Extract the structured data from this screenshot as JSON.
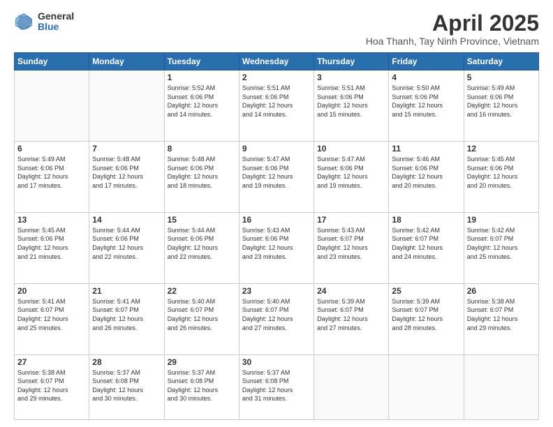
{
  "logo": {
    "general": "General",
    "blue": "Blue"
  },
  "header": {
    "title": "April 2025",
    "subtitle": "Hoa Thanh, Tay Ninh Province, Vietnam"
  },
  "weekdays": [
    "Sunday",
    "Monday",
    "Tuesday",
    "Wednesday",
    "Thursday",
    "Friday",
    "Saturday"
  ],
  "weeks": [
    [
      {
        "day": "",
        "info": ""
      },
      {
        "day": "",
        "info": ""
      },
      {
        "day": "1",
        "info": "Sunrise: 5:52 AM\nSunset: 6:06 PM\nDaylight: 12 hours\nand 14 minutes."
      },
      {
        "day": "2",
        "info": "Sunrise: 5:51 AM\nSunset: 6:06 PM\nDaylight: 12 hours\nand 14 minutes."
      },
      {
        "day": "3",
        "info": "Sunrise: 5:51 AM\nSunset: 6:06 PM\nDaylight: 12 hours\nand 15 minutes."
      },
      {
        "day": "4",
        "info": "Sunrise: 5:50 AM\nSunset: 6:06 PM\nDaylight: 12 hours\nand 15 minutes."
      },
      {
        "day": "5",
        "info": "Sunrise: 5:49 AM\nSunset: 6:06 PM\nDaylight: 12 hours\nand 16 minutes."
      }
    ],
    [
      {
        "day": "6",
        "info": "Sunrise: 5:49 AM\nSunset: 6:06 PM\nDaylight: 12 hours\nand 17 minutes."
      },
      {
        "day": "7",
        "info": "Sunrise: 5:48 AM\nSunset: 6:06 PM\nDaylight: 12 hours\nand 17 minutes."
      },
      {
        "day": "8",
        "info": "Sunrise: 5:48 AM\nSunset: 6:06 PM\nDaylight: 12 hours\nand 18 minutes."
      },
      {
        "day": "9",
        "info": "Sunrise: 5:47 AM\nSunset: 6:06 PM\nDaylight: 12 hours\nand 19 minutes."
      },
      {
        "day": "10",
        "info": "Sunrise: 5:47 AM\nSunset: 6:06 PM\nDaylight: 12 hours\nand 19 minutes."
      },
      {
        "day": "11",
        "info": "Sunrise: 5:46 AM\nSunset: 6:06 PM\nDaylight: 12 hours\nand 20 minutes."
      },
      {
        "day": "12",
        "info": "Sunrise: 5:45 AM\nSunset: 6:06 PM\nDaylight: 12 hours\nand 20 minutes."
      }
    ],
    [
      {
        "day": "13",
        "info": "Sunrise: 5:45 AM\nSunset: 6:06 PM\nDaylight: 12 hours\nand 21 minutes."
      },
      {
        "day": "14",
        "info": "Sunrise: 5:44 AM\nSunset: 6:06 PM\nDaylight: 12 hours\nand 22 minutes."
      },
      {
        "day": "15",
        "info": "Sunrise: 5:44 AM\nSunset: 6:06 PM\nDaylight: 12 hours\nand 22 minutes."
      },
      {
        "day": "16",
        "info": "Sunrise: 5:43 AM\nSunset: 6:06 PM\nDaylight: 12 hours\nand 23 minutes."
      },
      {
        "day": "17",
        "info": "Sunrise: 5:43 AM\nSunset: 6:07 PM\nDaylight: 12 hours\nand 23 minutes."
      },
      {
        "day": "18",
        "info": "Sunrise: 5:42 AM\nSunset: 6:07 PM\nDaylight: 12 hours\nand 24 minutes."
      },
      {
        "day": "19",
        "info": "Sunrise: 5:42 AM\nSunset: 6:07 PM\nDaylight: 12 hours\nand 25 minutes."
      }
    ],
    [
      {
        "day": "20",
        "info": "Sunrise: 5:41 AM\nSunset: 6:07 PM\nDaylight: 12 hours\nand 25 minutes."
      },
      {
        "day": "21",
        "info": "Sunrise: 5:41 AM\nSunset: 6:07 PM\nDaylight: 12 hours\nand 26 minutes."
      },
      {
        "day": "22",
        "info": "Sunrise: 5:40 AM\nSunset: 6:07 PM\nDaylight: 12 hours\nand 26 minutes."
      },
      {
        "day": "23",
        "info": "Sunrise: 5:40 AM\nSunset: 6:07 PM\nDaylight: 12 hours\nand 27 minutes."
      },
      {
        "day": "24",
        "info": "Sunrise: 5:39 AM\nSunset: 6:07 PM\nDaylight: 12 hours\nand 27 minutes."
      },
      {
        "day": "25",
        "info": "Sunrise: 5:39 AM\nSunset: 6:07 PM\nDaylight: 12 hours\nand 28 minutes."
      },
      {
        "day": "26",
        "info": "Sunrise: 5:38 AM\nSunset: 6:07 PM\nDaylight: 12 hours\nand 29 minutes."
      }
    ],
    [
      {
        "day": "27",
        "info": "Sunrise: 5:38 AM\nSunset: 6:07 PM\nDaylight: 12 hours\nand 29 minutes."
      },
      {
        "day": "28",
        "info": "Sunrise: 5:37 AM\nSunset: 6:08 PM\nDaylight: 12 hours\nand 30 minutes."
      },
      {
        "day": "29",
        "info": "Sunrise: 5:37 AM\nSunset: 6:08 PM\nDaylight: 12 hours\nand 30 minutes."
      },
      {
        "day": "30",
        "info": "Sunrise: 5:37 AM\nSunset: 6:08 PM\nDaylight: 12 hours\nand 31 minutes."
      },
      {
        "day": "",
        "info": ""
      },
      {
        "day": "",
        "info": ""
      },
      {
        "day": "",
        "info": ""
      }
    ]
  ]
}
